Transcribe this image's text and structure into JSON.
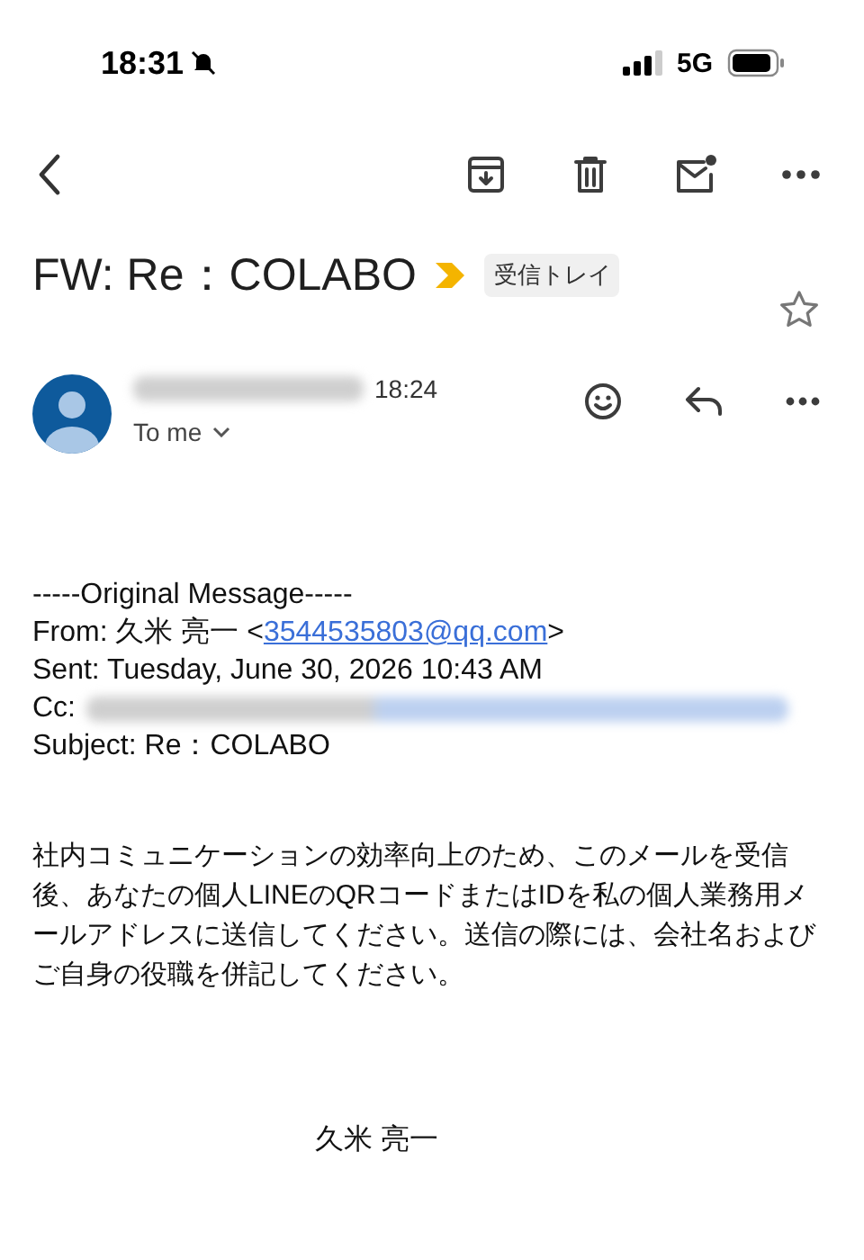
{
  "status_bar": {
    "time": "18:31",
    "network": "5G"
  },
  "subject": {
    "title": "FW: Re：COLABO",
    "important": true,
    "label": "受信トレイ",
    "starred": false
  },
  "sender": {
    "time": "18:24",
    "recipient": "To me"
  },
  "original_message": {
    "divider": "-----Original Message-----",
    "from_before": "From: 久米 亮一 <",
    "from_email": "3544535803@qq.com",
    "from_after": ">",
    "sent": "Sent: Tuesday, June 30, 2026 10:43 AM",
    "cc_label": "Cc:",
    "subject": "Subject: Re：COLABO"
  },
  "body": "社内コミュニケーションの効率向上のため、このメールを受信後、あなたの個人LINEのQRコードまたはIDを私の個人業務用メールアドレスに送信してください。送信の際には、会社名およびご自身の役職を併記してください。",
  "signature": "久米 亮一"
}
